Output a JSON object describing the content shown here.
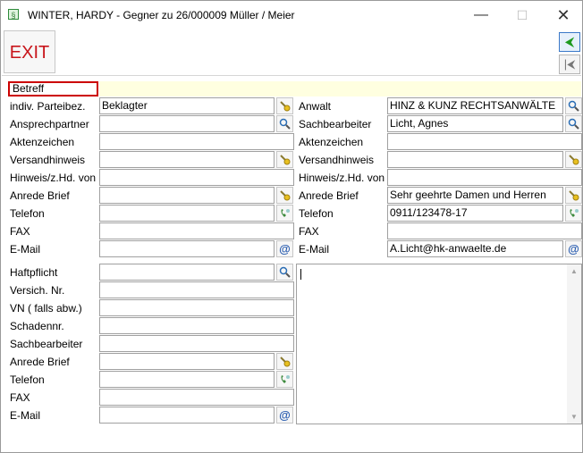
{
  "window": {
    "title": "WINTER, HARDY - Gegner zu 26/000009 Müller / Meier",
    "icon_glyph": "§",
    "minimize_glyph": "—",
    "maximize_glyph": "☐",
    "close_glyph": "✕"
  },
  "toolbar": {
    "exit_label": "EXIT",
    "back_glyph": "⮜",
    "first_glyph": "|⮜"
  },
  "betreff": {
    "label": "Betreff",
    "value": ""
  },
  "left": {
    "parteibez": {
      "label": "indiv. Parteibez.",
      "value": "Beklagter"
    },
    "ansprechpartner": {
      "label": "Ansprechpartner",
      "value": ""
    },
    "aktenzeichen": {
      "label": "Aktenzeichen",
      "value": ""
    },
    "versandhinweis": {
      "label": "Versandhinweis",
      "value": ""
    },
    "hinweis": {
      "label": "Hinweis/z.Hd. von",
      "value": ""
    },
    "anrede": {
      "label": "Anrede Brief",
      "value": ""
    },
    "telefon": {
      "label": "Telefon",
      "value": ""
    },
    "fax": {
      "label": "FAX",
      "value": ""
    },
    "email": {
      "label": "E-Mail",
      "value": ""
    }
  },
  "right": {
    "anwalt": {
      "label": "Anwalt",
      "value": "HINZ & KUNZ RECHTSANWÄLTE"
    },
    "sachbearbeiter": {
      "label": "Sachbearbeiter",
      "value": "Licht, Agnes"
    },
    "aktenzeichen": {
      "label": "Aktenzeichen",
      "value": ""
    },
    "versandhinweis": {
      "label": "Versandhinweis",
      "value": ""
    },
    "hinweis": {
      "label": "Hinweis/z.Hd. von",
      "value": ""
    },
    "anrede": {
      "label": "Anrede Brief",
      "value": "Sehr geehrte Damen und Herren"
    },
    "telefon": {
      "label": "Telefon",
      "value": "0911/123478-17"
    },
    "fax": {
      "label": "FAX",
      "value": ""
    },
    "email": {
      "label": "E-Mail",
      "value": "A.Licht@hk-anwaelte.de"
    }
  },
  "insurance": {
    "haftpflicht": {
      "label": "Haftpflicht",
      "value": ""
    },
    "versich_nr": {
      "label": "Versich. Nr.",
      "value": ""
    },
    "vn": {
      "label": "VN ( falls abw.)",
      "value": ""
    },
    "schadennr": {
      "label": "Schadennr.",
      "value": ""
    },
    "sachbearbeiter": {
      "label": "Sachbearbeiter",
      "value": ""
    },
    "anrede": {
      "label": "Anrede Brief",
      "value": ""
    },
    "telefon": {
      "label": "Telefon",
      "value": ""
    },
    "fax": {
      "label": "FAX",
      "value": ""
    },
    "email": {
      "label": "E-Mail",
      "value": ""
    }
  },
  "notes": {
    "value": ""
  },
  "icons": {
    "search": "search-icon",
    "pick": "picker-icon",
    "phone": "phone-icon",
    "at": "at-sign-icon"
  },
  "colors": {
    "exit_text": "#c8151b",
    "betreff_border": "#cc0000",
    "betreff_bg": "#ffffe0",
    "back_arrow": "#1e9a1e"
  }
}
